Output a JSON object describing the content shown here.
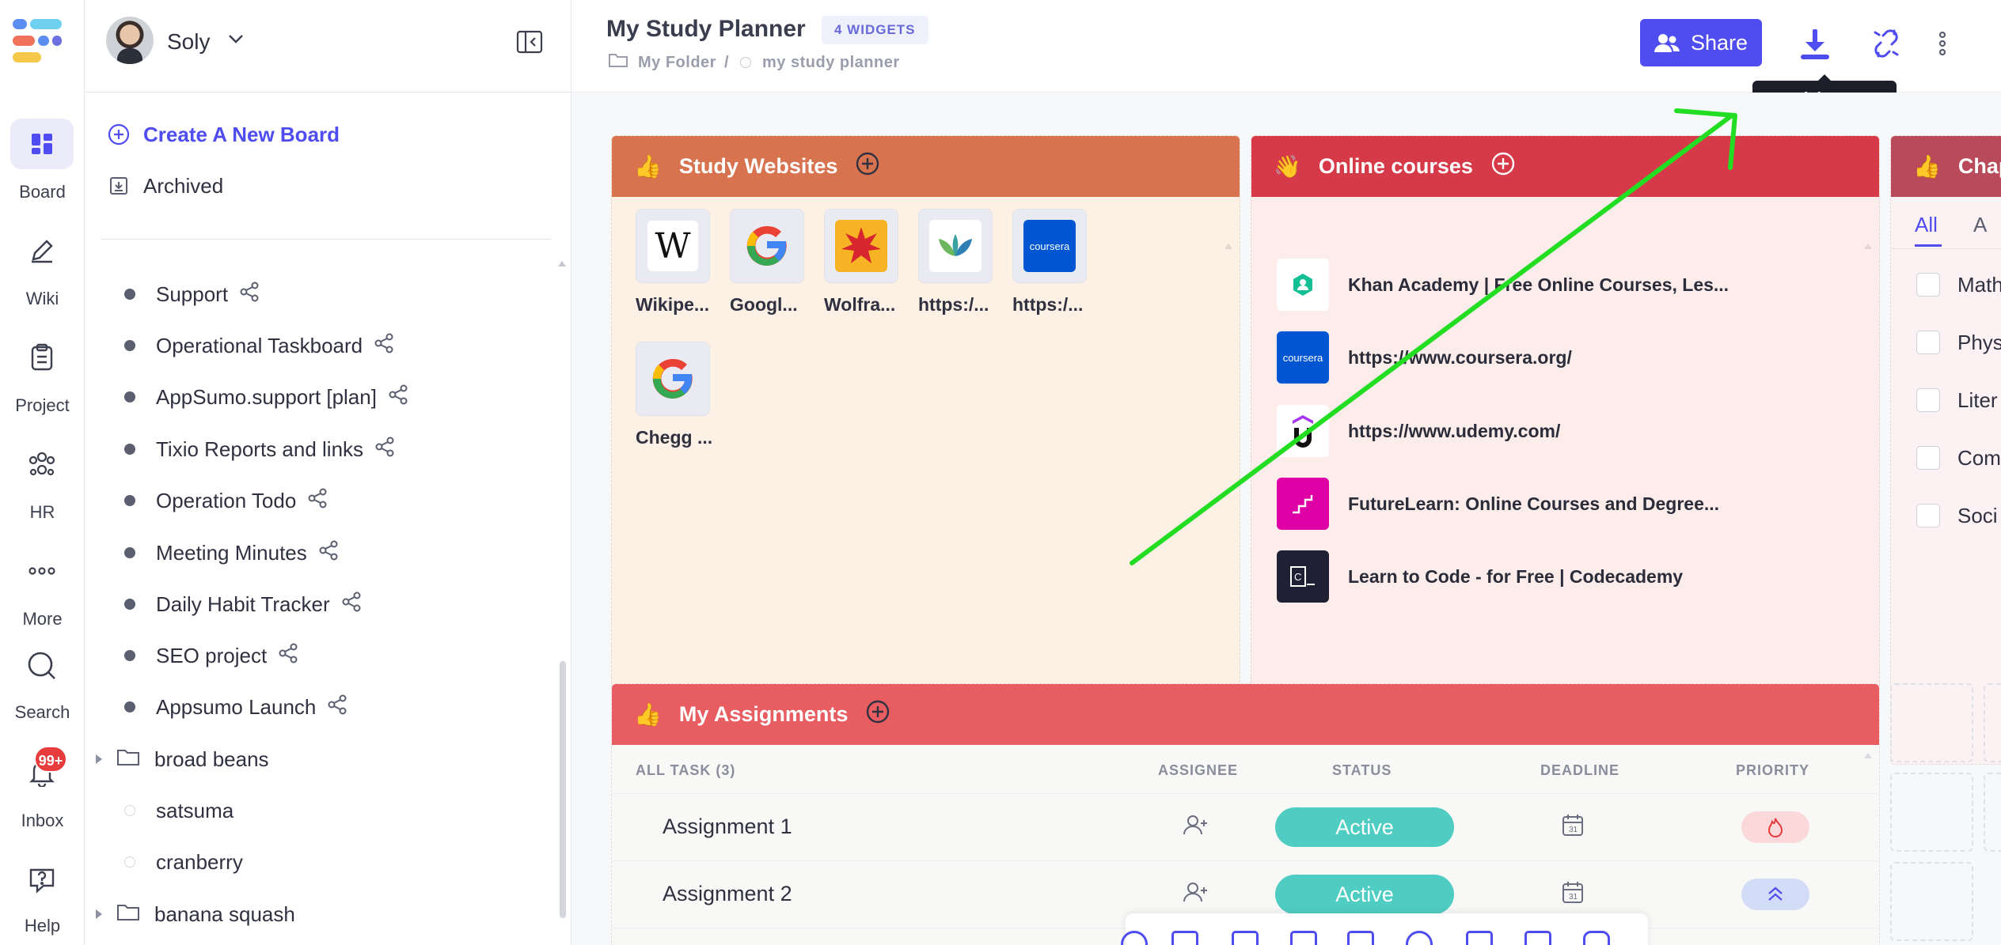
{
  "rail": {
    "items": [
      {
        "label": "Board",
        "icon": "board-icon"
      },
      {
        "label": "Wiki",
        "icon": "pencil-icon"
      },
      {
        "label": "Project",
        "icon": "clipboard-icon"
      },
      {
        "label": "HR",
        "icon": "people-icon"
      },
      {
        "label": "More",
        "icon": "more-dots-icon"
      },
      {
        "label": "Search",
        "icon": "search-icon"
      },
      {
        "label": "Inbox",
        "icon": "bell-icon"
      },
      {
        "label": "Help",
        "icon": "help-icon"
      }
    ],
    "inbox_badge": "99+"
  },
  "sidebar": {
    "user_name": "Soly",
    "create_board": "Create A New Board",
    "archived": "Archived",
    "boards": [
      "Support",
      "Operational Taskboard",
      "AppSumo.support [plan]",
      "Tixio Reports and links",
      "Operation Todo",
      "Meeting Minutes",
      "Daily Habit Tracker",
      "SEO project",
      "Appsumo Launch"
    ],
    "folder_1": "broad beans",
    "plain_1": "satsuma",
    "plain_2": "cranberry",
    "folder_2": "banana squash"
  },
  "header": {
    "title": "My Study Planner",
    "widgets_badge": "4 WIDGETS",
    "crumb_folder": "My Folder",
    "crumb_sep": "/",
    "crumb_page": "my study planner",
    "share_label": "Share",
    "tooltip": "Quick Save"
  },
  "widgets": {
    "study_websites": {
      "title": "Study Websites",
      "emoji": "👍",
      "color": "#d8734f",
      "bg": "#fdf0e4",
      "tiles": [
        "Wikipe...",
        "Googl...",
        "Wolfra...",
        "https:/...",
        "https:/...",
        "Chegg ..."
      ]
    },
    "online_courses": {
      "title": "Online courses",
      "emoji": "👋",
      "color": "#d63a48",
      "bg": "#fcecea",
      "links": [
        "Khan Academy | Free Online Courses, Les...",
        "https://www.coursera.org/",
        "https://www.udemy.com/",
        "FutureLearn: Online Courses and Degree...",
        "Learn to Code - for Free | Codecademy"
      ]
    },
    "chapters": {
      "title": "Chap",
      "emoji": "👍",
      "tab_all": "All",
      "tab_next": "A",
      "items": [
        "Math",
        "Phys",
        "Liter",
        "Com",
        "Soci"
      ]
    },
    "assignments": {
      "title": "My Assignments",
      "emoji": "👍",
      "color": "#e85d61",
      "columns": [
        "ALL TASK (3)",
        "ASSIGNEE",
        "STATUS",
        "DEADLINE",
        "PRIORITY"
      ],
      "rows": [
        {
          "name": "Assignment 1",
          "status": "Active",
          "priority": "high"
        },
        {
          "name": "Assignment 2",
          "status": "Active",
          "priority": "medium"
        }
      ]
    }
  },
  "colors": {
    "accent": "#4f4cf0",
    "status_active": "#4fcdc3",
    "annotation_arrow": "#22dd22"
  }
}
